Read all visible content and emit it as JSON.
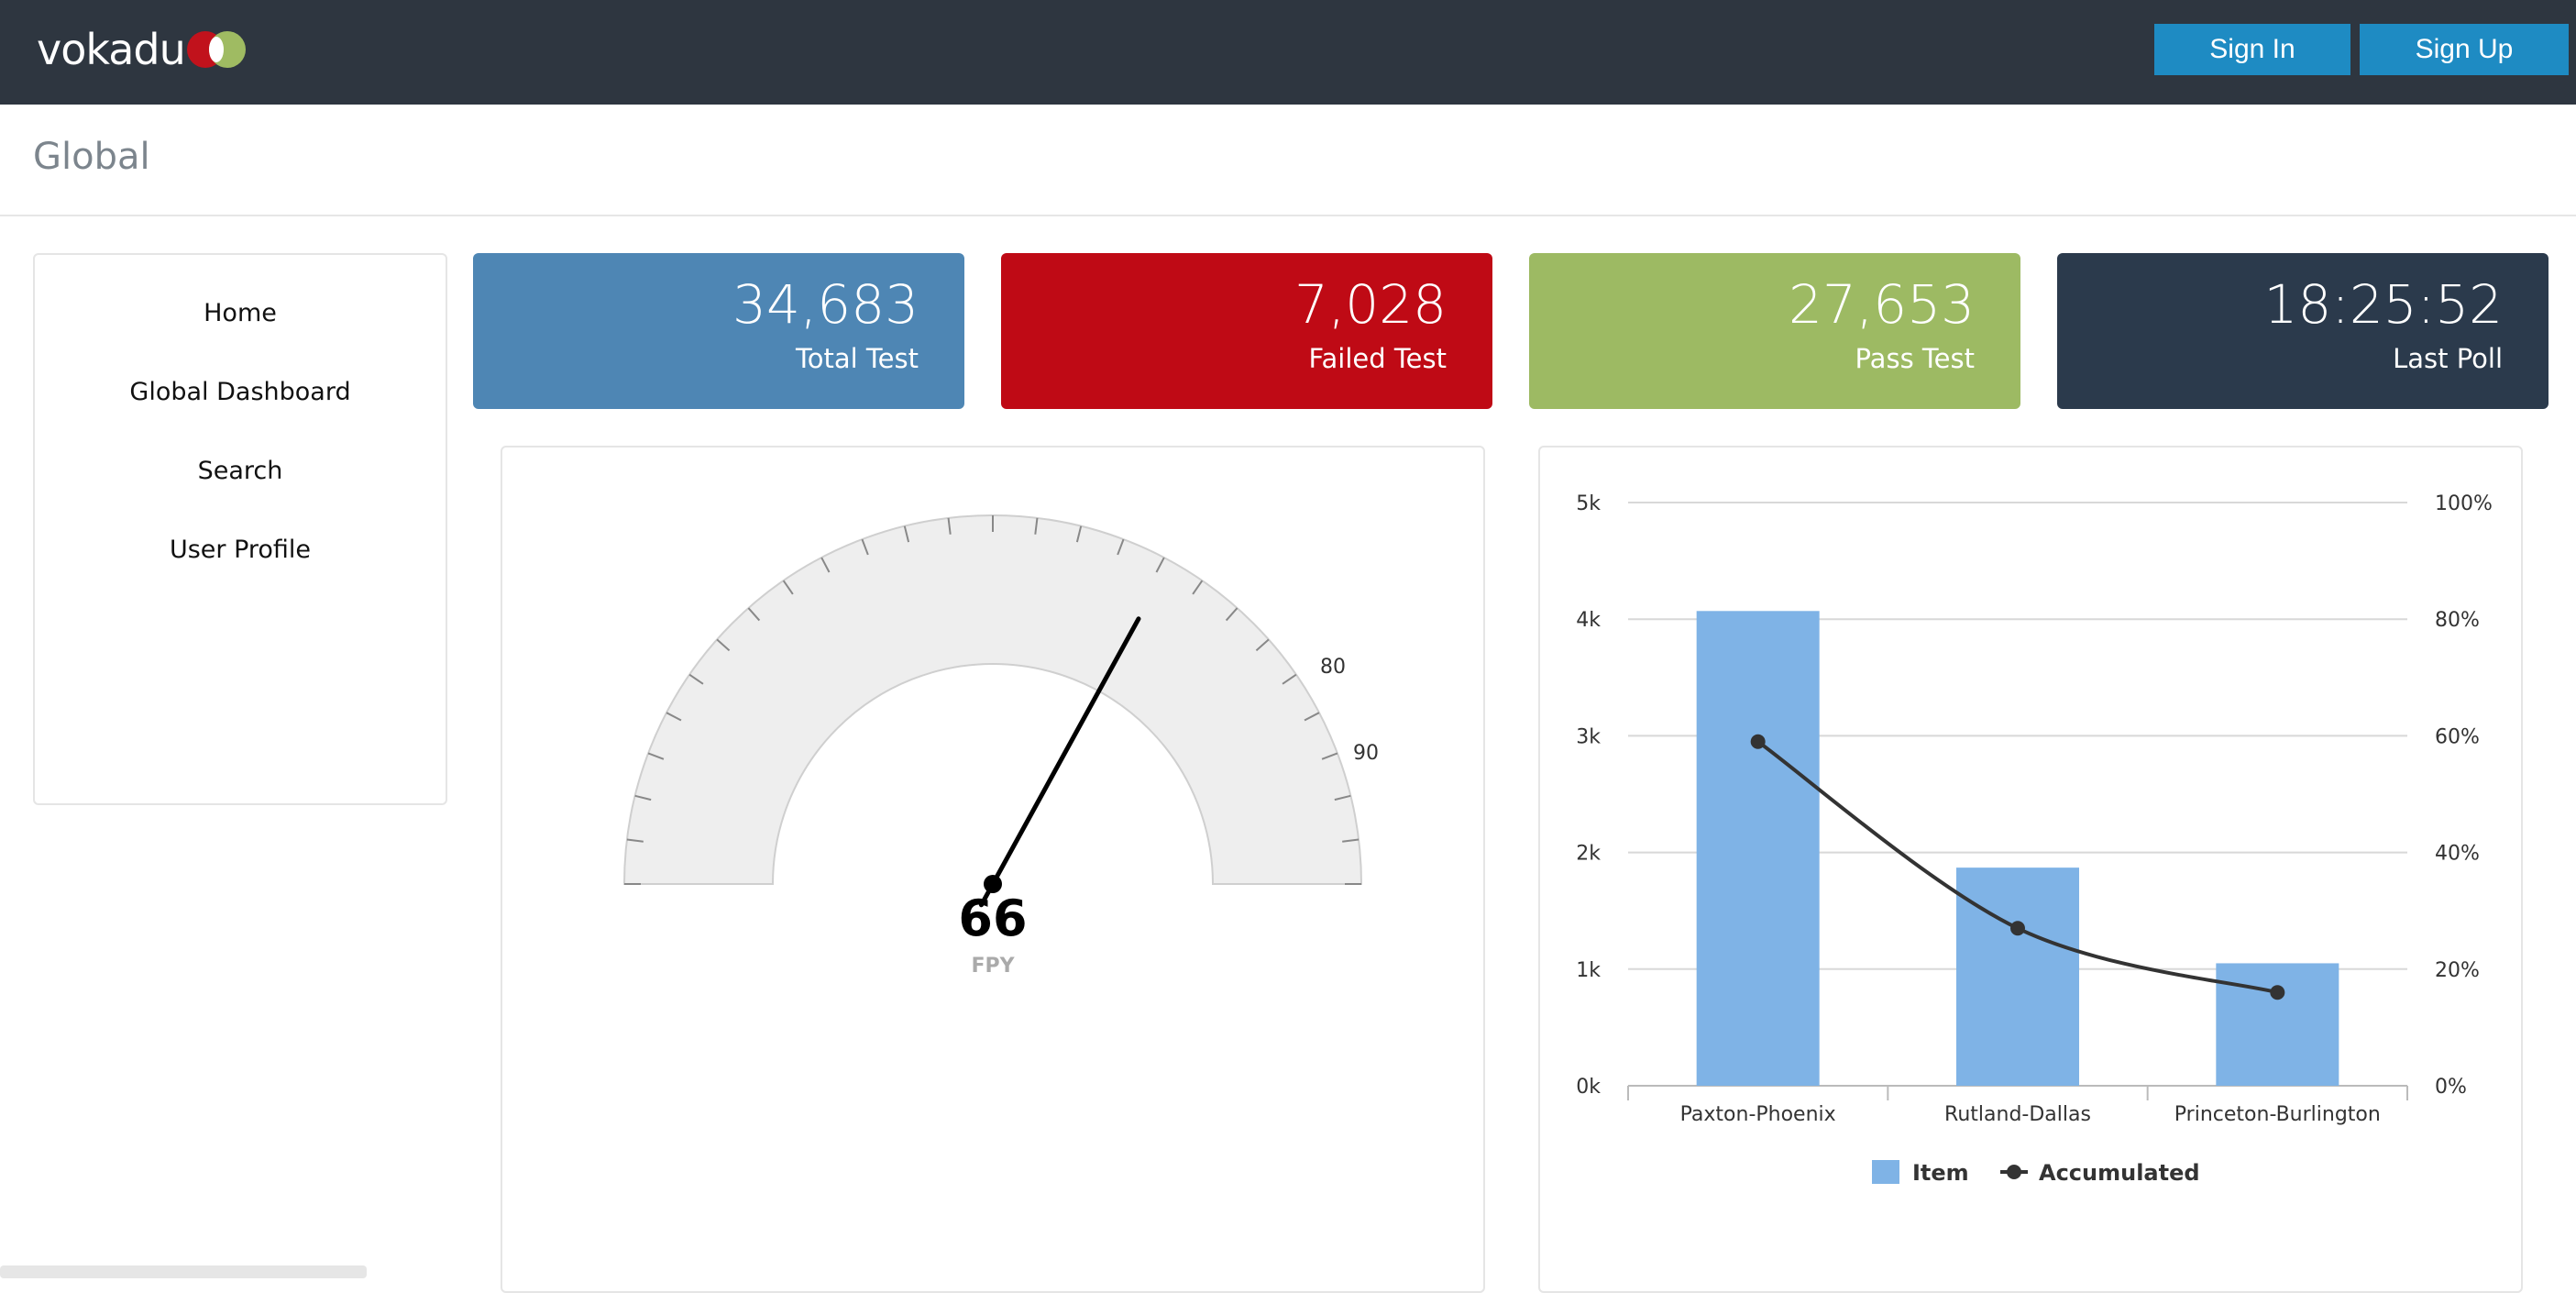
{
  "header": {
    "logo_text": "vokadu",
    "sign_in": "Sign In",
    "sign_up": "Sign Up"
  },
  "page": {
    "title": "Global"
  },
  "sidebar": {
    "items": [
      {
        "label": "Home"
      },
      {
        "label": "Global Dashboard"
      },
      {
        "label": "Search"
      },
      {
        "label": "User Profile"
      }
    ]
  },
  "stats": {
    "total": {
      "value": "34,683",
      "label": "Total Test"
    },
    "failed": {
      "value": "7,028",
      "label": "Failed Test"
    },
    "pass": {
      "value": "27,653",
      "label": "Pass Test"
    },
    "poll": {
      "value": "18:25:52",
      "label": "Last Poll"
    }
  },
  "colors": {
    "accent": "#1e8bc3",
    "total": "#4e86b4",
    "failed": "#bf0a15",
    "pass": "#9dba63",
    "poll": "#2b3a4c",
    "bar": "#7fb3e6",
    "line": "#333333"
  },
  "gauge": {
    "value": 66,
    "label": "FPY",
    "min": 0,
    "max": 100,
    "visible_tick_labels": [
      "80",
      "90"
    ]
  },
  "chart_data": {
    "type": "bar",
    "categories": [
      "Paxton-Phoenix",
      "Rutland-Dallas",
      "Princeton-Burlington"
    ],
    "series": [
      {
        "name": "Item",
        "type": "bar",
        "axis": "left",
        "values": [
          4070,
          1870,
          1050
        ]
      },
      {
        "name": "Accumulated",
        "type": "line",
        "axis": "right",
        "values": [
          59,
          27,
          16
        ]
      }
    ],
    "y_left": {
      "ticks": [
        "0k",
        "1k",
        "2k",
        "3k",
        "4k",
        "5k"
      ],
      "ylim": [
        0,
        5000
      ]
    },
    "y_right": {
      "ticks": [
        "0%",
        "20%",
        "40%",
        "60%",
        "80%",
        "100%"
      ],
      "ylim": [
        0,
        100
      ]
    },
    "grid": true,
    "legend": "bottom-center"
  }
}
